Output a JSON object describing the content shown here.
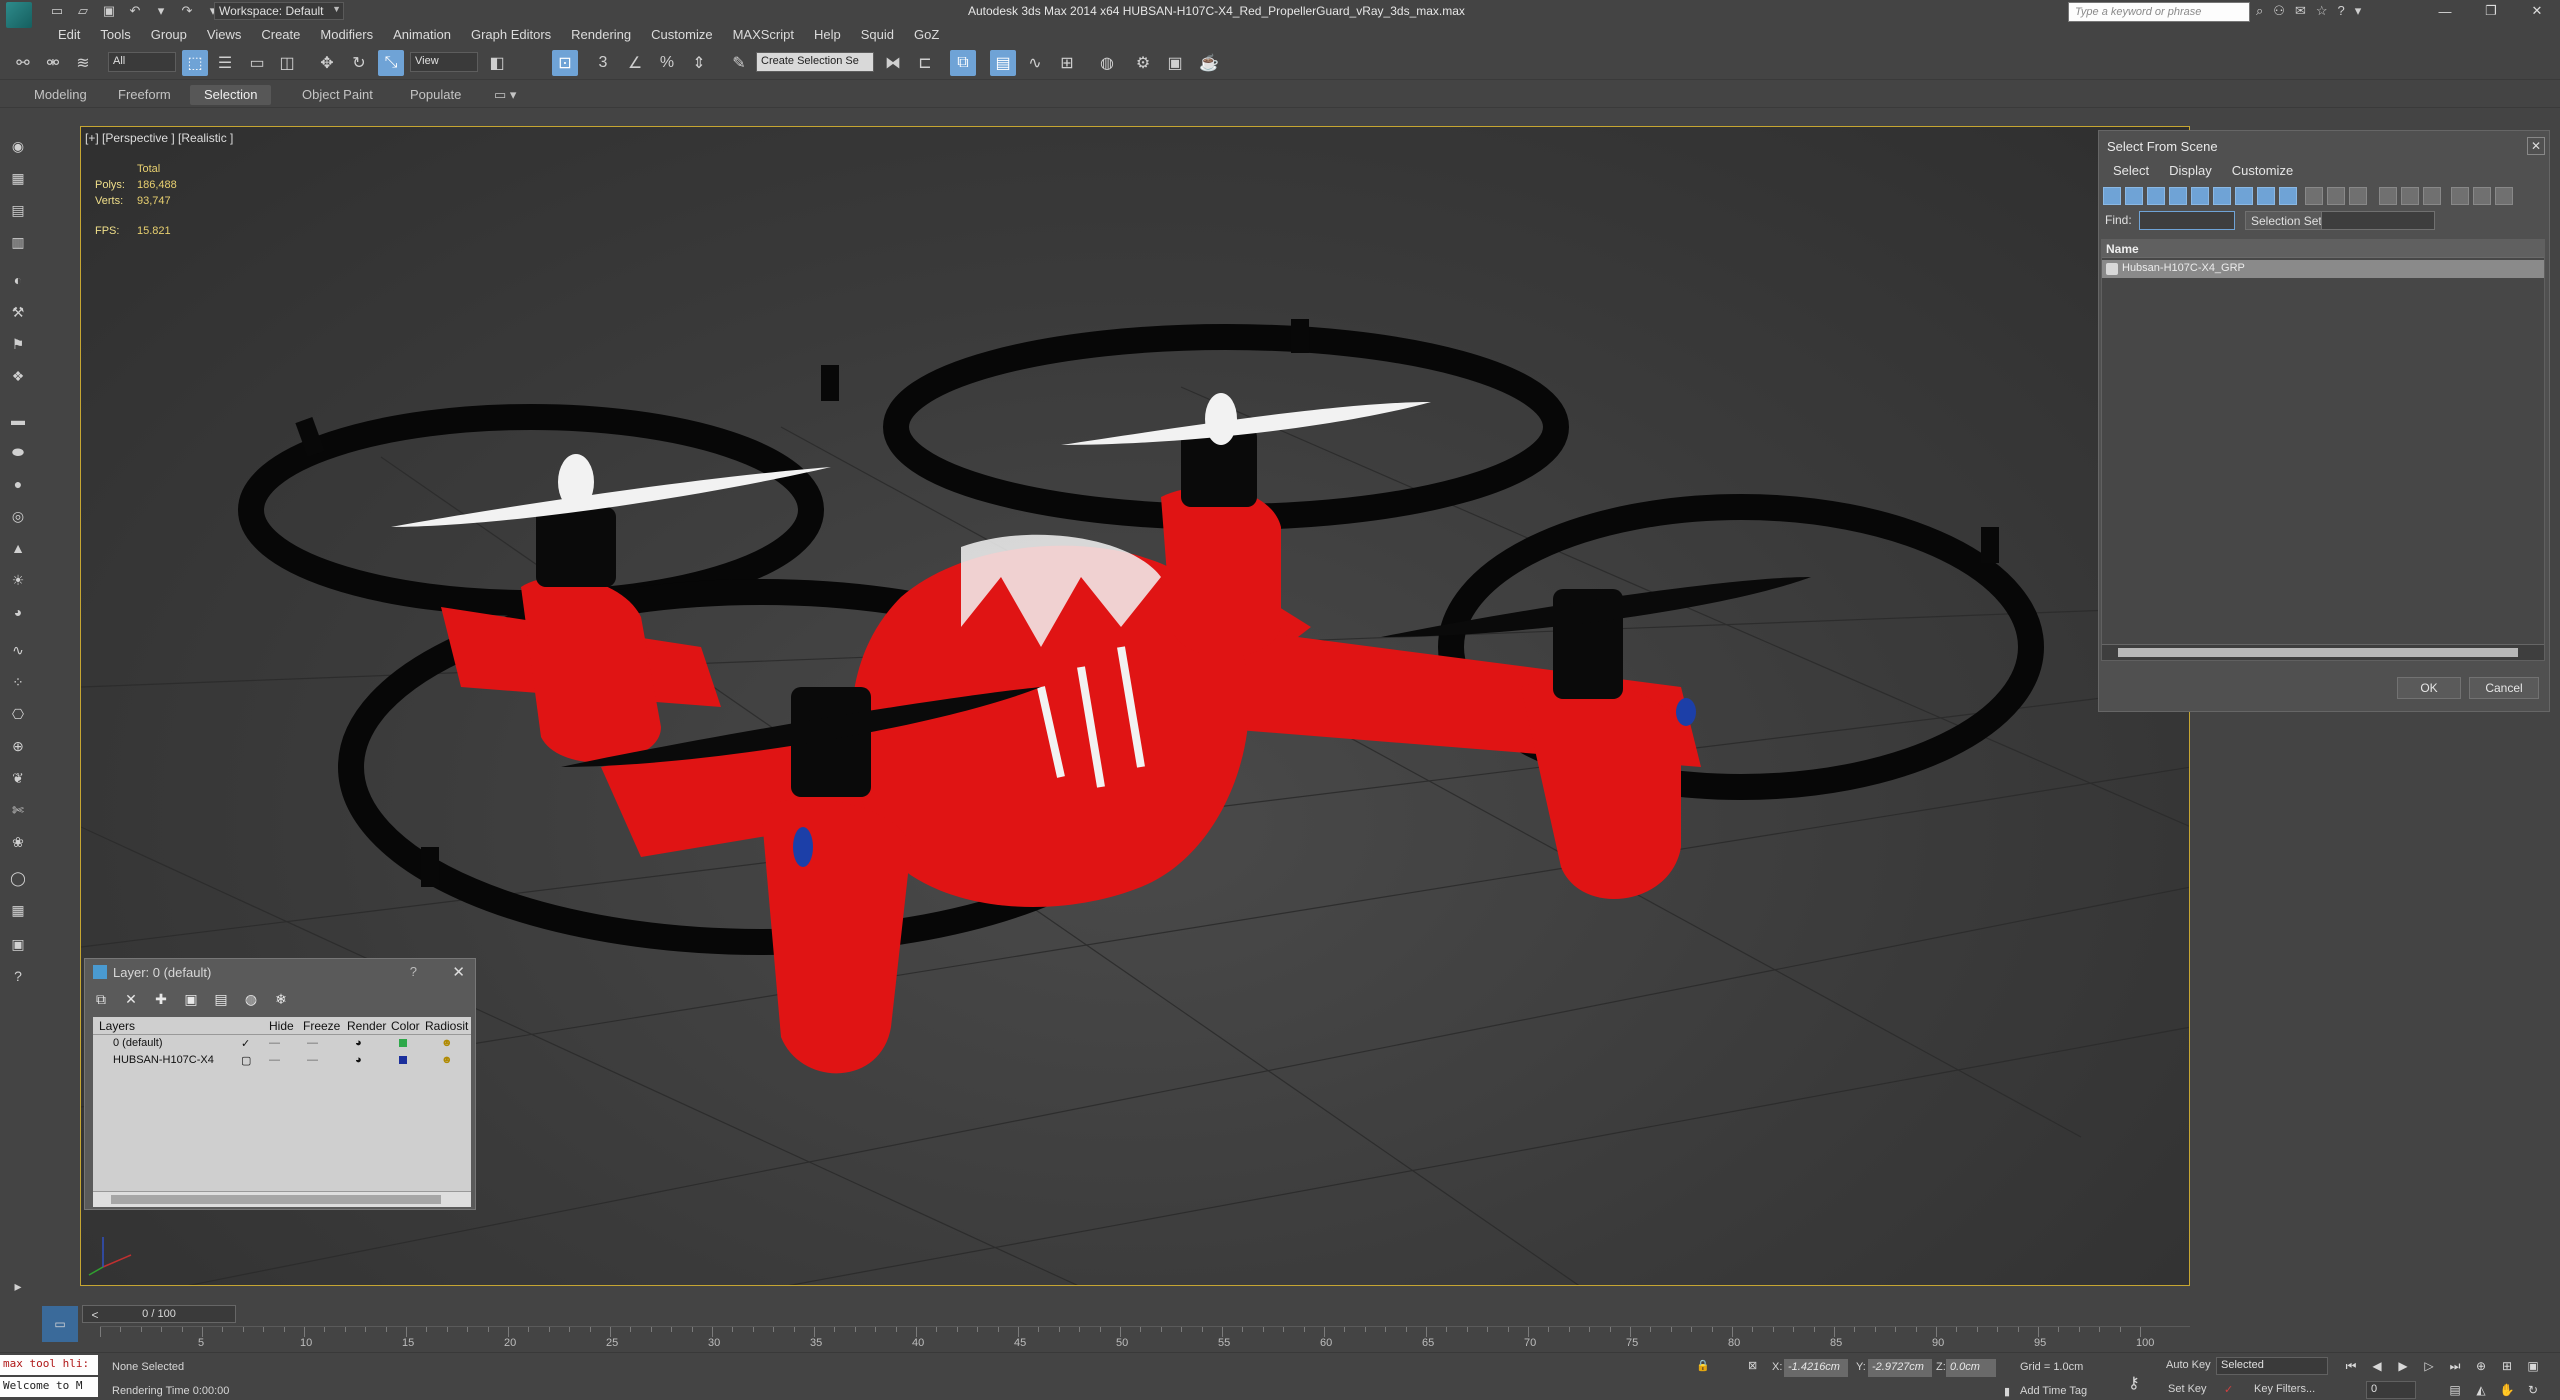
{
  "window": {
    "title": "Autodesk 3ds Max  2014 x64      HUBSAN-H107C-X4_Red_PropellerGuard_vRay_3ds_max.max",
    "workspace": "Workspace: Default",
    "search_placeholder": "Type a keyword or phrase"
  },
  "menu": [
    "Edit",
    "Tools",
    "Group",
    "Views",
    "Create",
    "Modifiers",
    "Animation",
    "Graph Editors",
    "Rendering",
    "Customize",
    "MAXScript",
    "Help",
    "Squid",
    "GoZ"
  ],
  "toolbar": {
    "filter": "All",
    "coord_system": "View",
    "selection_set": "Create Selection Se"
  },
  "ribbon_tabs": [
    "Modeling",
    "Freeform",
    "Selection",
    "Object Paint",
    "Populate"
  ],
  "ribbon_active": "Selection",
  "viewport": {
    "label": "[+] [Perspective ] [Realistic ]",
    "stats_header": "Total",
    "polys_label": "Polys:",
    "polys_value": "186,488",
    "verts_label": "Verts:",
    "verts_value": "93,747",
    "fps_label": "FPS:",
    "fps_value": "15.821"
  },
  "select_from_scene": {
    "title": "Select From Scene",
    "menu": [
      "Select",
      "Display",
      "Customize"
    ],
    "find_label": "Find:",
    "selection_set_label": "Selection Set:",
    "column_name": "Name",
    "rows": [
      "Hubsan-H107C-X4_GRP"
    ],
    "ok": "OK",
    "cancel": "Cancel"
  },
  "layer_dialog": {
    "title": "Layer: 0 (default)",
    "help": "?",
    "columns": [
      "Layers",
      "Hide",
      "Freeze",
      "Render",
      "Color",
      "Radiosit"
    ],
    "rows": [
      {
        "name": "0 (default)",
        "color": "#2ea84a"
      },
      {
        "name": "HUBSAN-H107C-X4",
        "color": "#1b2f9c"
      }
    ]
  },
  "timeline": {
    "frame_display": "0 / 100",
    "ticks": [
      "5",
      "10",
      "15",
      "20",
      "25",
      "30",
      "35",
      "40",
      "45",
      "50",
      "55",
      "60",
      "65",
      "70",
      "75",
      "80",
      "85",
      "90",
      "95",
      "100"
    ]
  },
  "status": {
    "maxscript_line1": "max tool hli:",
    "maxscript_line2": "Welcome to M",
    "selection": "None Selected",
    "render_time": "Rendering Time  0:00:00",
    "x_label": "X:",
    "x_value": "-1.4216cm",
    "y_label": "Y:",
    "y_value": "-2.9727cm",
    "z_label": "Z:",
    "z_value": "0.0cm",
    "grid": "Grid = 1.0cm",
    "add_time_tag": "Add Time Tag",
    "auto_key": "Auto Key",
    "set_key": "Set Key",
    "key_mode": "Selected",
    "key_filters": "Key Filters...",
    "frame_field": "0"
  },
  "colors": {
    "viewport_border": "#c6a632",
    "drone_body": "#e01414",
    "selection_accent": "#6fa3d6"
  }
}
